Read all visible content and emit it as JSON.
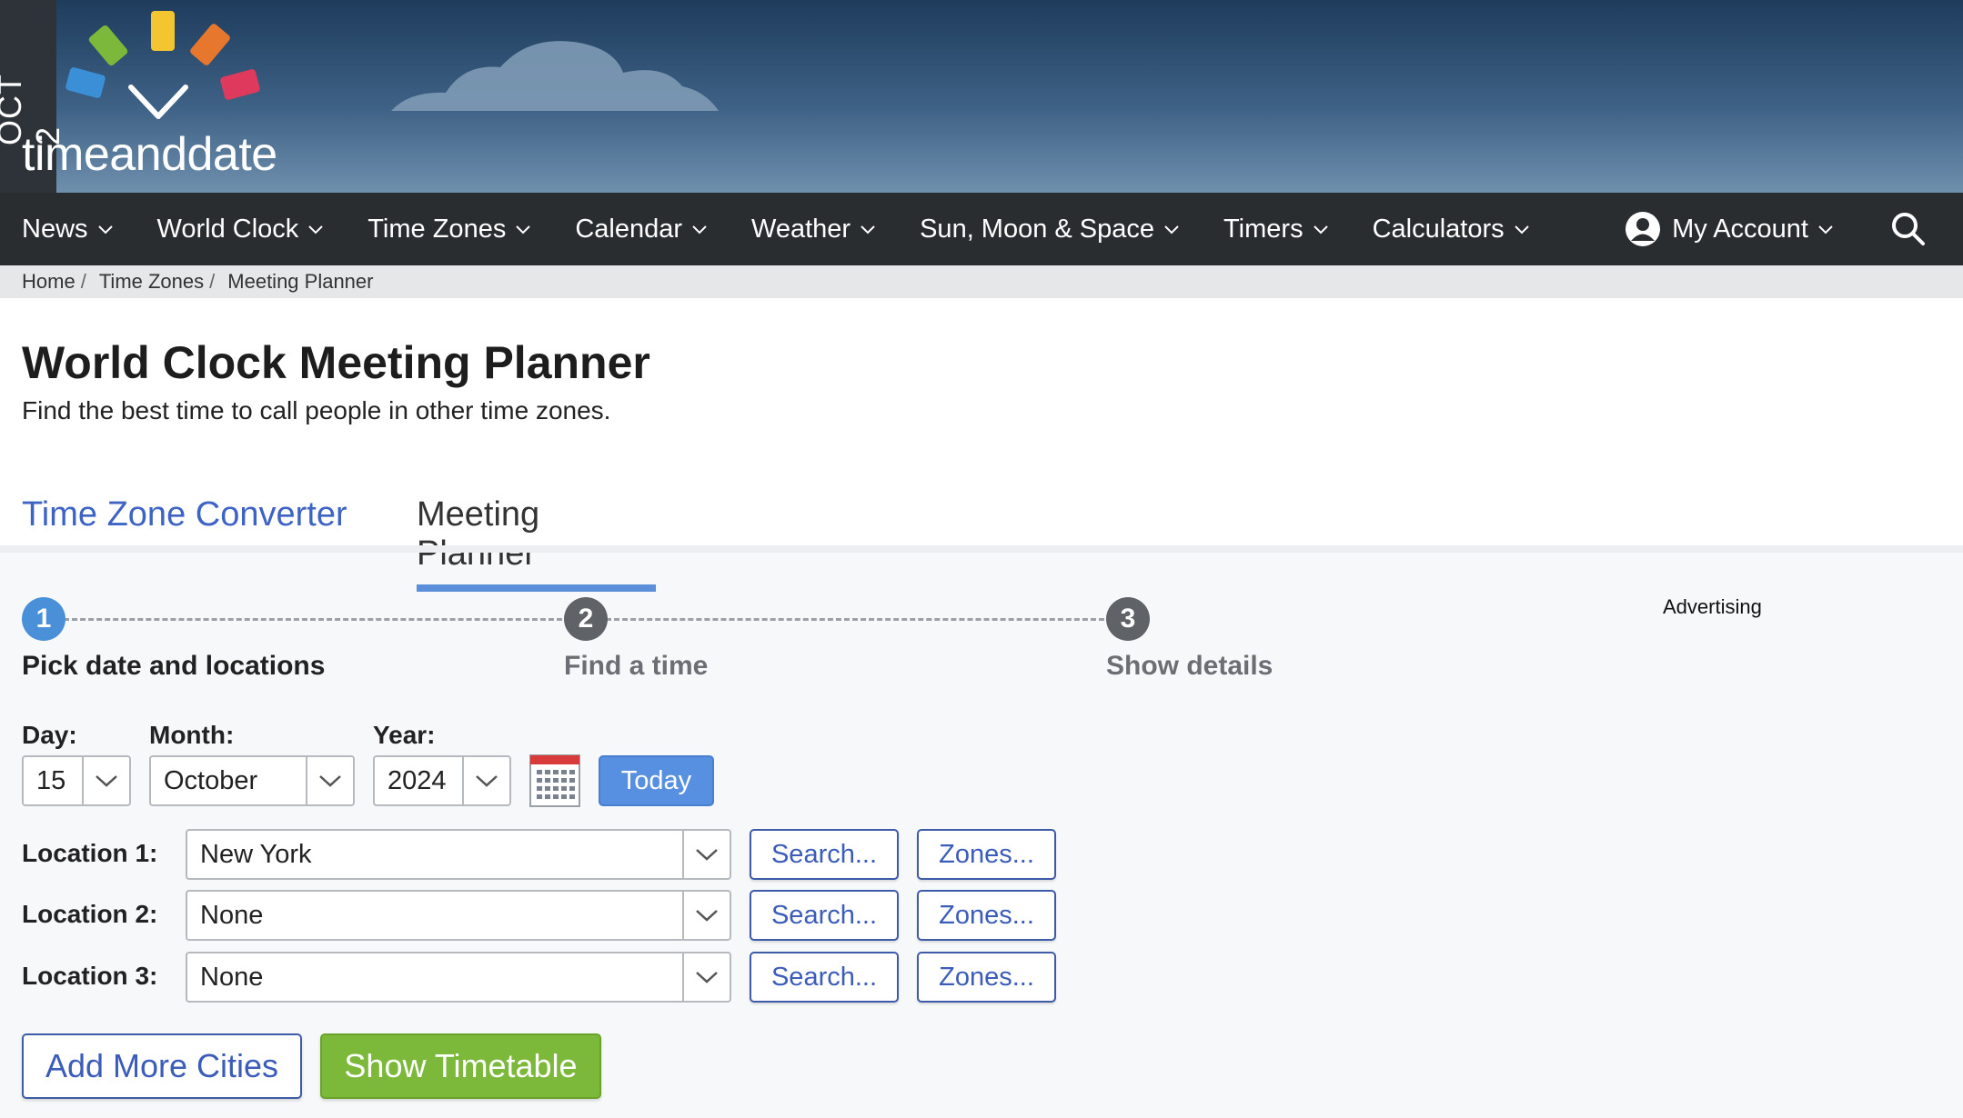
{
  "header": {
    "date_strip": "OCT 2",
    "logo_text": "timeanddate"
  },
  "nav": {
    "items": [
      {
        "label": "News"
      },
      {
        "label": "World Clock"
      },
      {
        "label": "Time Zones"
      },
      {
        "label": "Calendar"
      },
      {
        "label": "Weather"
      },
      {
        "label": "Sun, Moon & Space"
      },
      {
        "label": "Timers"
      },
      {
        "label": "Calculators"
      }
    ],
    "account_label": "My Account"
  },
  "breadcrumb": {
    "items": [
      "Home",
      "Time Zones",
      "Meeting Planner"
    ],
    "separator": "/"
  },
  "page": {
    "title": "World Clock Meeting Planner",
    "subtitle": "Find the best time to call people in other time zones."
  },
  "tabs": {
    "converter": "Time Zone Converter",
    "planner": "Meeting Planner"
  },
  "steps": [
    {
      "number": "1",
      "label": "Pick date and locations",
      "active": true
    },
    {
      "number": "2",
      "label": "Find a time",
      "active": false
    },
    {
      "number": "3",
      "label": "Show details",
      "active": false
    }
  ],
  "advertising": "Advertising",
  "form": {
    "day_label": "Day:",
    "month_label": "Month:",
    "year_label": "Year:",
    "day_value": "15",
    "month_value": "October",
    "year_value": "2024",
    "today_label": "Today",
    "locations": [
      {
        "label": "Location 1:",
        "value": "New York"
      },
      {
        "label": "Location 2:",
        "value": "None"
      },
      {
        "label": "Location 3:",
        "value": "None"
      }
    ],
    "search_label": "Search...",
    "zones_label": "Zones...",
    "add_more_label": "Add More Cities",
    "show_timetable_label": "Show Timetable"
  },
  "colors": {
    "nav_bg": "#2a2d30",
    "accent_blue": "#5790e0",
    "link_blue": "#3b5cb8",
    "step_active": "#4a90d9",
    "step_inactive": "#5f6368",
    "show_green": "#7cb83a"
  }
}
